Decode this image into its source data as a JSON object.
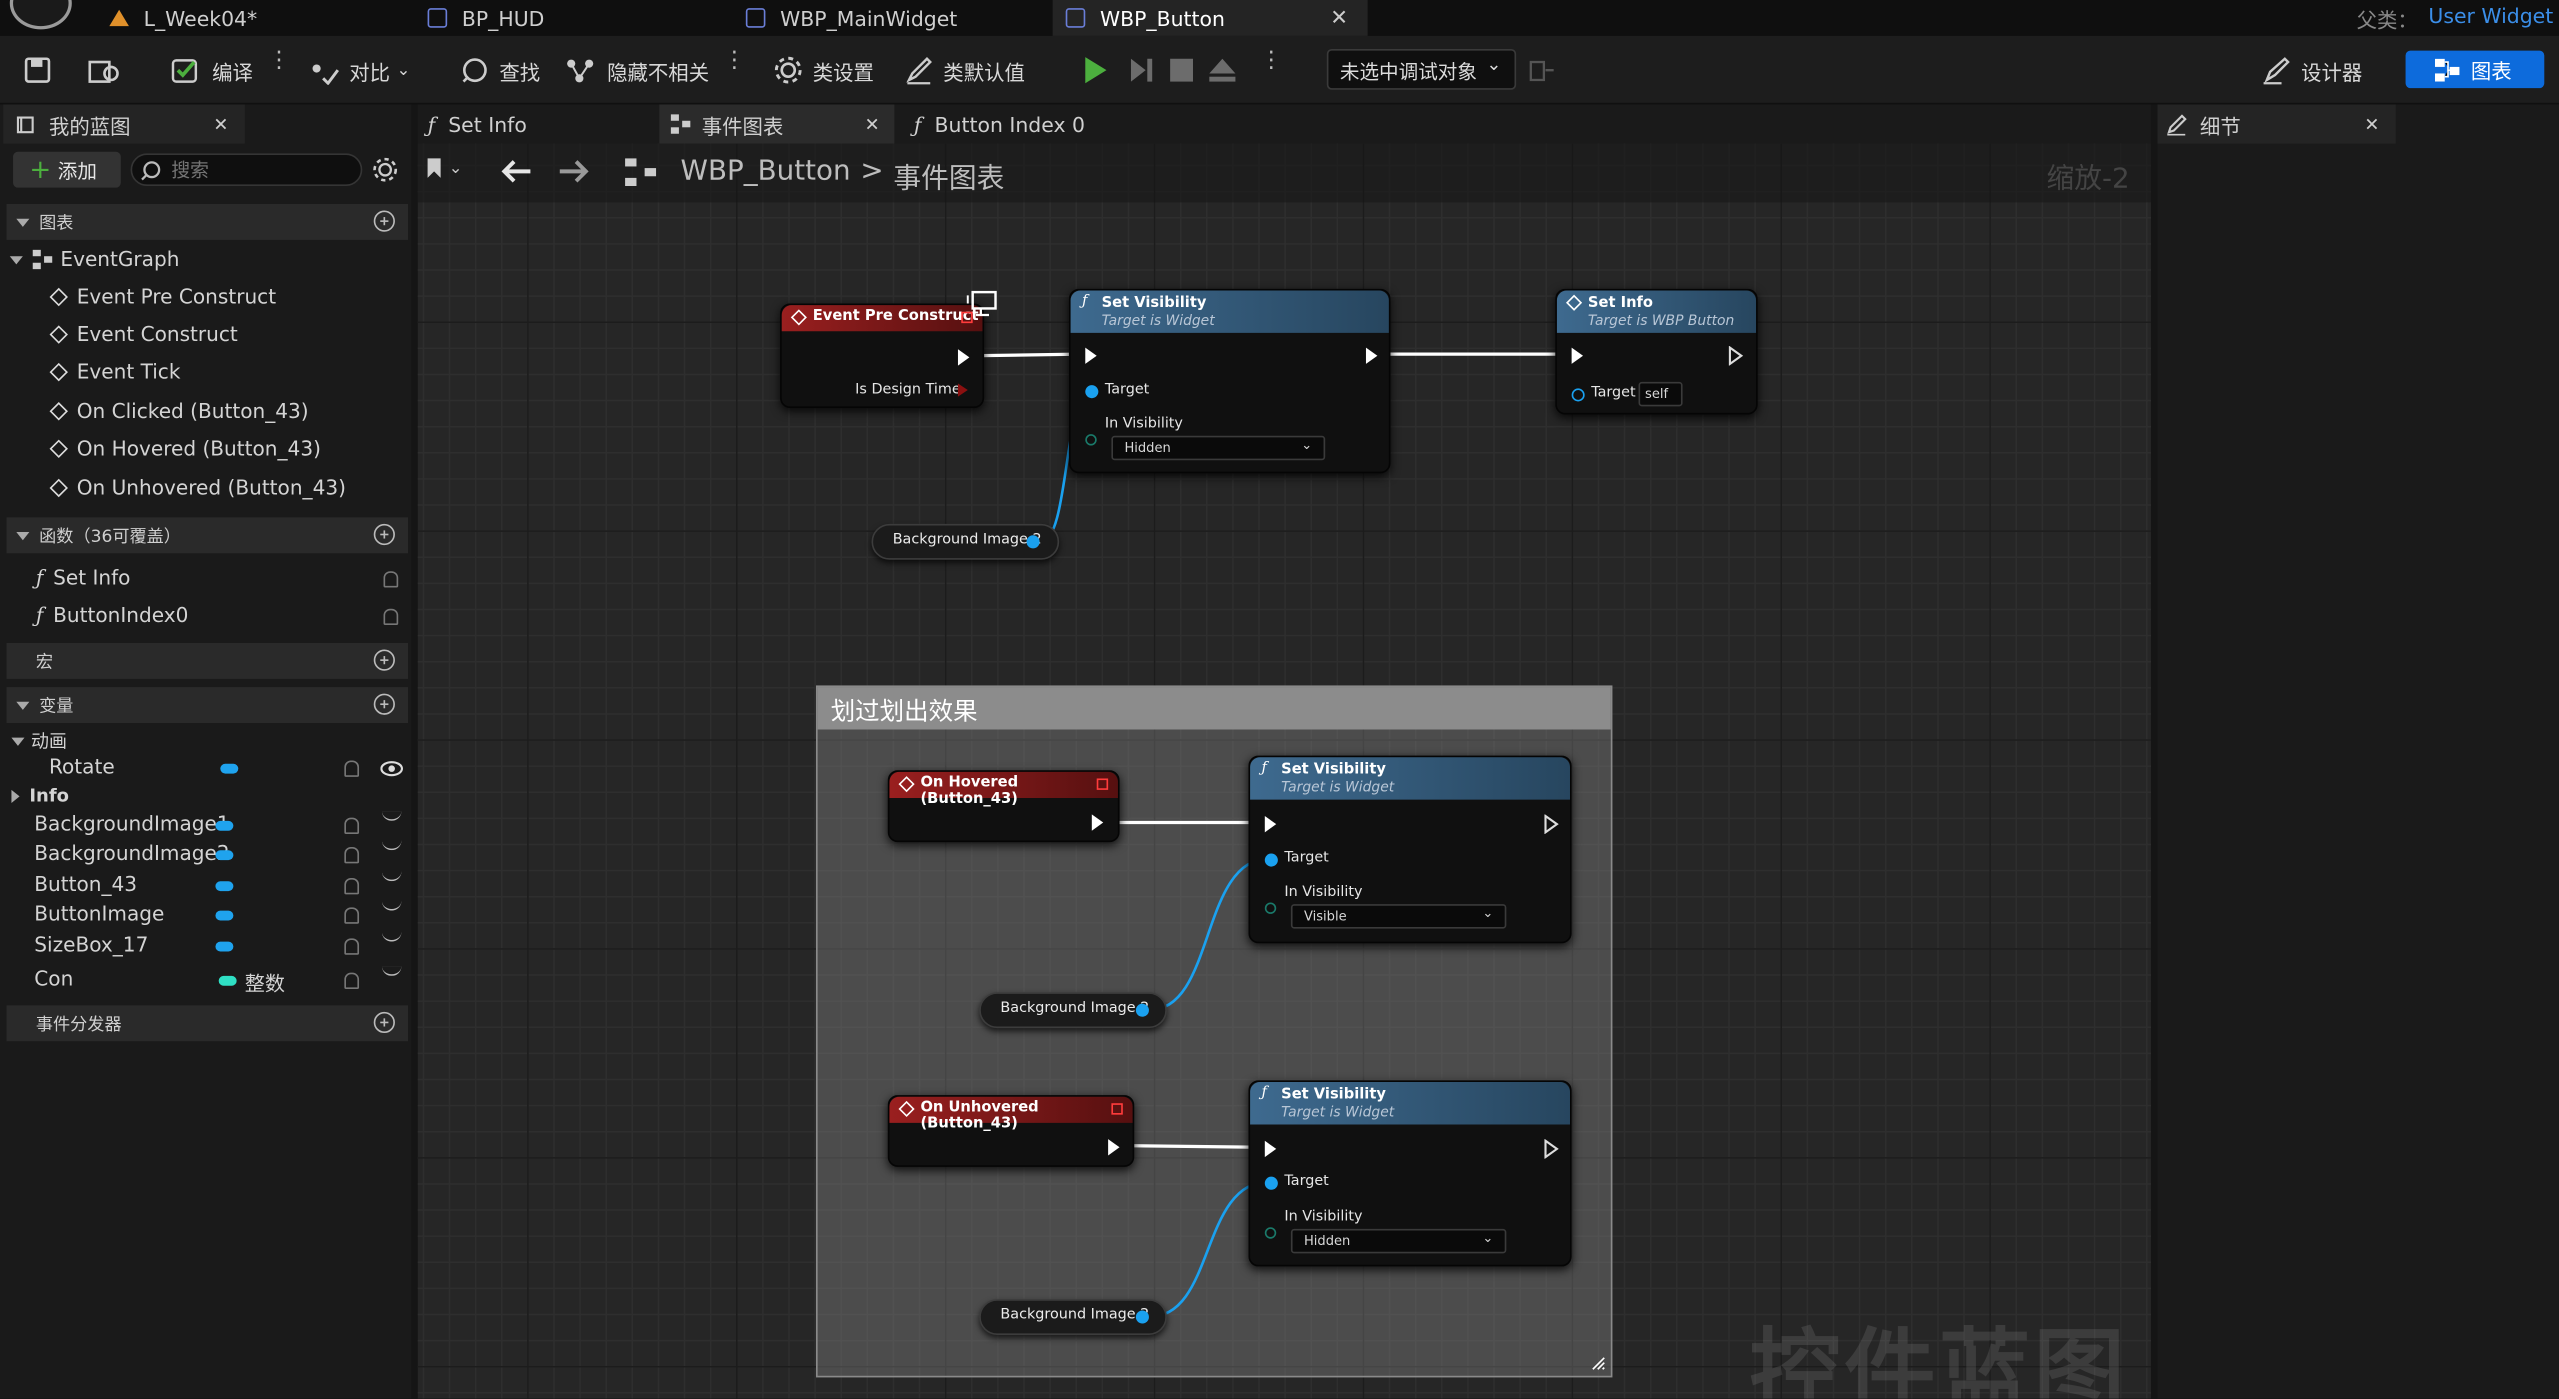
{
  "tabs": [
    {
      "label": "L_Week04*"
    },
    {
      "label": "BP_HUD"
    },
    {
      "label": "WBP_MainWidget"
    },
    {
      "label": "WBP_Button"
    }
  ],
  "parent_class": {
    "label": "父类：",
    "value": "User Widget"
  },
  "toolbar": {
    "compile": "编译",
    "diff": "对比",
    "find": "查找",
    "hide_unrelated": "隐藏不相关",
    "class_settings": "类设置",
    "class_defaults": "类默认值",
    "debug_object": "未选中调试对象",
    "designer": "设计器",
    "graph": "图表"
  },
  "colors": {
    "accent": "#0d6bdc",
    "play_green": "#4caf3e",
    "event_red": "#9a1f1f",
    "function_blue": "#3e6a8f",
    "var_pin": "#1aa1f0",
    "int_pin": "#2fe0c4"
  },
  "left_panel": {
    "title": "我的蓝图",
    "add_label": "添加",
    "search_placeholder": "搜索",
    "graphs_header": "图表",
    "event_graph": "EventGraph",
    "events": [
      "Event Pre Construct",
      "Event Construct",
      "Event Tick",
      "On Clicked (Button_43)",
      "On Hovered (Button_43)",
      "On Unhovered (Button_43)"
    ],
    "functions_header": "函数（36可覆盖）",
    "functions": [
      "Set Info",
      "ButtonIndex0"
    ],
    "macros_header": "宏",
    "variables_header": "变量",
    "var_category_anim": "动画",
    "var_rotate": "Rotate",
    "var_category_info": "Info",
    "variables": [
      "BackgroundImage1",
      "BackgroundImage2",
      "Button_43",
      "ButtonImage",
      "SizeBox_17"
    ],
    "var_con": "Con",
    "var_con_type": "整数",
    "dispatchers_header": "事件分发器"
  },
  "doc_tabs": [
    {
      "label": "Set Info"
    },
    {
      "label": "事件图表"
    },
    {
      "label": "Button Index 0"
    }
  ],
  "breadcrumb": {
    "root": "WBP_Button",
    "sep": ">",
    "current": "事件图表"
  },
  "zoom_label": "缩放-2",
  "details_title": "细节",
  "nodes": {
    "event_pre_construct": {
      "title": "Event Pre Construct",
      "pin": "Is Design Time"
    },
    "set_visibility_1": {
      "title": "Set Visibility",
      "subtitle": "Target is Widget",
      "target": "Target",
      "in_visibility": "In Visibility",
      "value": "Hidden"
    },
    "set_info": {
      "title": "Set Info",
      "subtitle": "Target is WBP Button",
      "target": "Target",
      "value": "self"
    },
    "bg_image_1": "Background Image 2",
    "comment": "划过划出效果",
    "on_hovered": {
      "title": "On Hovered (Button_43)"
    },
    "set_visibility_2": {
      "title": "Set Visibility",
      "subtitle": "Target is Widget",
      "target": "Target",
      "in_visibility": "In Visibility",
      "value": "Visible"
    },
    "bg_image_2": "Background Image 2",
    "on_unhovered": {
      "title": "On Unhovered (Button_43)"
    },
    "set_visibility_3": {
      "title": "Set Visibility",
      "subtitle": "Target is Widget",
      "target": "Target",
      "in_visibility": "In Visibility",
      "value": "Hidden"
    },
    "bg_image_3": "Background Image 2"
  },
  "watermark": "控件蓝图"
}
